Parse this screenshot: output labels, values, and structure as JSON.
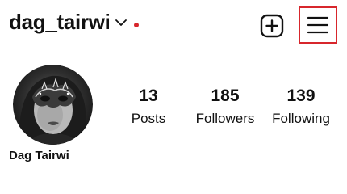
{
  "header": {
    "username": "dag_tairwi",
    "notification_dot_color": "#d7262c",
    "icons": {
      "dropdown": "chevron-down-icon",
      "create": "plus-square-icon",
      "menu": "hamburger-menu-icon"
    },
    "highlight_color": "#d7262c"
  },
  "profile": {
    "avatar_icon": "profile-photo",
    "display_name": "Dag Tairwi"
  },
  "stats": [
    {
      "value": "13",
      "label": "Posts"
    },
    {
      "value": "185",
      "label": "Followers"
    },
    {
      "value": "139",
      "label": "Following"
    }
  ]
}
